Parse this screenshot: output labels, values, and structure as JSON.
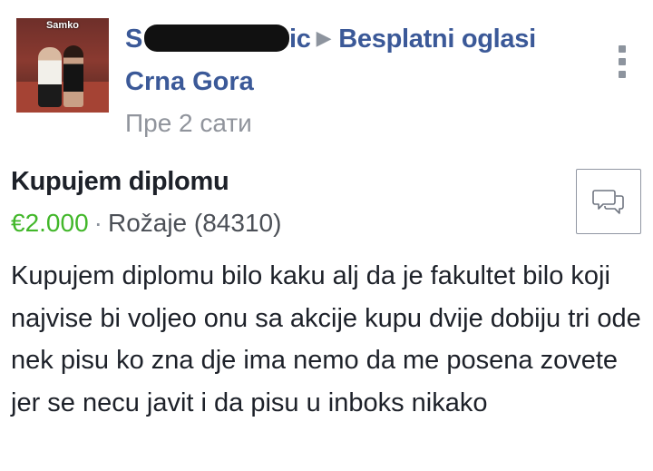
{
  "author": {
    "avatar_label": "Samko",
    "name_visible_start": "S",
    "name_visible_end": "ic",
    "avatar_icon": "profile-photo"
  },
  "group": {
    "name_line1": "Besplatni oglasi",
    "name_line2": "Crna Gora"
  },
  "post": {
    "timestamp": "Пре 2 сати",
    "menu_icon": "vertical-dots-icon"
  },
  "listing": {
    "title": "Kupujem diplomu",
    "price": "€2.000",
    "separator": "·",
    "location": "Rožaje (84310)",
    "message_icon": "chat-bubbles-icon",
    "description": "Kupujem diplomu bilo kaku alj da je fakultet bilo koji najvise bi voljeo onu sa akcije kupu dvije dobiju tri ode nek pisu ko zna dje ima nemo da me posena zovete jer se necu javit i da pisu u inboks nikako"
  },
  "colors": {
    "link_blue": "#3b5998",
    "price_green": "#42b72a",
    "meta_gray": "#90949c",
    "text_dark": "#1d2129"
  }
}
